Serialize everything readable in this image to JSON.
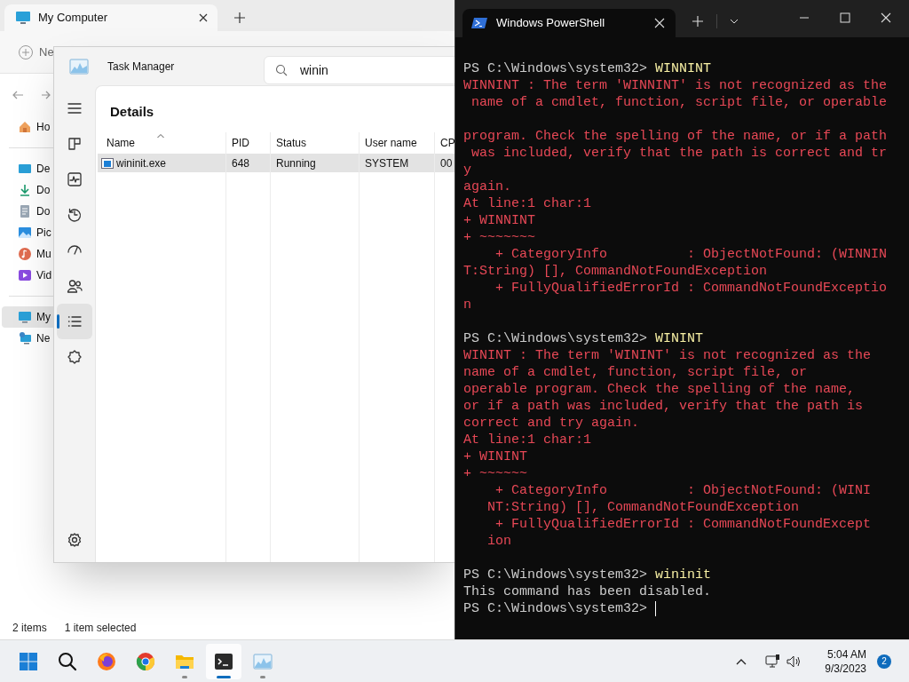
{
  "explorer": {
    "tab_title": "My Computer",
    "toolbar_label": "Ne",
    "sidebar_sections": [
      {
        "items": [
          {
            "kind": "home",
            "label": "Ho",
            "selected": false
          }
        ]
      },
      {
        "items": [
          {
            "kind": "desktop",
            "label": "De",
            "selected": false
          },
          {
            "kind": "downloads",
            "label": "Do",
            "selected": false
          },
          {
            "kind": "documents",
            "label": "Do",
            "selected": false
          },
          {
            "kind": "pictures",
            "label": "Pic",
            "selected": false
          },
          {
            "kind": "music",
            "label": "Mu",
            "selected": false
          },
          {
            "kind": "videos",
            "label": "Vid",
            "selected": false
          }
        ]
      },
      {
        "items": [
          {
            "kind": "computer",
            "label": "My",
            "selected": true
          },
          {
            "kind": "network",
            "label": "Ne",
            "selected": false
          }
        ]
      }
    ],
    "status_count": "2 items",
    "status_selection": "1 item selected"
  },
  "task_manager": {
    "title": "Task Manager",
    "search_value": "winin",
    "page_title": "Details",
    "nav_items": [
      {
        "kind": "processes",
        "selected": false
      },
      {
        "kind": "performance",
        "selected": false
      },
      {
        "kind": "history",
        "selected": false
      },
      {
        "kind": "startup",
        "selected": false
      },
      {
        "kind": "users",
        "selected": false
      },
      {
        "kind": "details",
        "selected": true
      },
      {
        "kind": "services",
        "selected": false
      }
    ],
    "columns": [
      {
        "label": "Name",
        "sorted": true
      },
      {
        "label": "PID",
        "sorted": false
      },
      {
        "label": "Status",
        "sorted": false
      },
      {
        "label": "User name",
        "sorted": false
      },
      {
        "label": "CP",
        "sorted": false
      }
    ],
    "rows": [
      {
        "cells": [
          "wininit.exe",
          "648",
          "Running",
          "SYSTEM",
          "00"
        ],
        "selected": true
      }
    ]
  },
  "powershell": {
    "tab_title": "Windows PowerShell",
    "cursor": true,
    "lines": [
      {
        "kind": "command",
        "prompt": "PS C:\\Windows\\system32>",
        "text": "WINNINT"
      },
      {
        "kind": "error",
        "text": "WINNINT : The term 'WINNINT' is not recognized as the"
      },
      {
        "kind": "error",
        "text": " name of a cmdlet, function, script file, or operable"
      },
      {
        "kind": "blank"
      },
      {
        "kind": "error",
        "text": "program. Check the spelling of the name, or if a path"
      },
      {
        "kind": "error",
        "text": " was included, verify that the path is correct and tr"
      },
      {
        "kind": "error",
        "text": "y"
      },
      {
        "kind": "error",
        "text": "again."
      },
      {
        "kind": "error",
        "text": "At line:1 char:1"
      },
      {
        "kind": "error",
        "text": "+ WINNINT"
      },
      {
        "kind": "error",
        "text": "+ ~~~~~~~"
      },
      {
        "kind": "error",
        "text": "    + CategoryInfo          : ObjectNotFound: (WINNIN"
      },
      {
        "kind": "error",
        "text": "T:String) [], CommandNotFoundException"
      },
      {
        "kind": "error",
        "text": "    + FullyQualifiedErrorId : CommandNotFoundExceptio"
      },
      {
        "kind": "error",
        "text": "n"
      },
      {
        "kind": "blank"
      },
      {
        "kind": "command",
        "prompt": "PS C:\\Windows\\system32>",
        "text": "WININT"
      },
      {
        "kind": "error",
        "text": "WININT : The term 'WININT' is not recognized as the"
      },
      {
        "kind": "error",
        "text": "name of a cmdlet, function, script file, or"
      },
      {
        "kind": "error",
        "text": "operable program. Check the spelling of the name,"
      },
      {
        "kind": "error",
        "text": "or if a path was included, verify that the path is"
      },
      {
        "kind": "error",
        "text": "correct and try again."
      },
      {
        "kind": "error",
        "text": "At line:1 char:1"
      },
      {
        "kind": "error",
        "text": "+ WININT"
      },
      {
        "kind": "error",
        "text": "+ ~~~~~~"
      },
      {
        "kind": "error",
        "text": "    + CategoryInfo          : ObjectNotFound: (WINI"
      },
      {
        "kind": "error",
        "text": "   NT:String) [], CommandNotFoundException"
      },
      {
        "kind": "error",
        "text": "    + FullyQualifiedErrorId : CommandNotFoundExcept"
      },
      {
        "kind": "error",
        "text": "   ion"
      },
      {
        "kind": "blank"
      },
      {
        "kind": "command",
        "prompt": "PS C:\\Windows\\system32>",
        "text": "wininit"
      },
      {
        "kind": "output",
        "text": "This command has been disabled."
      },
      {
        "kind": "prompt",
        "prompt": "PS C:\\Windows\\system32>"
      }
    ]
  },
  "taskbar": {
    "apps": [
      {
        "kind": "start",
        "running": false,
        "active": false
      },
      {
        "kind": "search",
        "running": false,
        "active": false
      },
      {
        "kind": "firefox",
        "running": false,
        "active": false
      },
      {
        "kind": "chrome",
        "running": false,
        "active": false
      },
      {
        "kind": "explorer",
        "running": true,
        "active": false
      },
      {
        "kind": "terminal",
        "running": true,
        "active": true
      },
      {
        "kind": "taskmanager",
        "running": true,
        "active": false
      }
    ],
    "time": "5:04 AM",
    "date": "9/3/2023",
    "notification_count": "2"
  }
}
